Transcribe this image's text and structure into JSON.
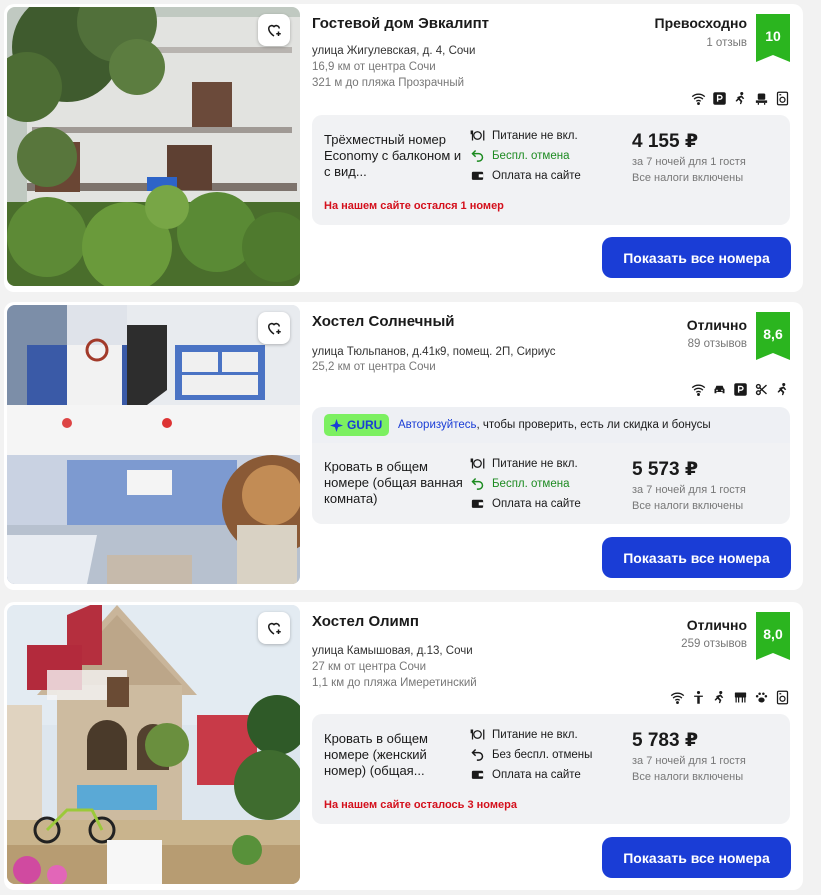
{
  "hotels": [
    {
      "name": "Гостевой дом Эвкалипт",
      "address": "улица Жигулевская, д. 4, Сочи",
      "distance_center": "16,9 км от центра Сочи",
      "distance_beach": "321 м до пляжа Прозрачный",
      "rating_word": "Превосходно",
      "reviews": "1 отзыв",
      "score": "10",
      "amenities": [
        "wifi-icon",
        "parking-icon",
        "kids-icon",
        "meeting-icon",
        "washer-icon"
      ],
      "room": "Трёхместный номер Economy с балконом и с вид...",
      "meal": "Питание не вкл.",
      "cancel": "Беспл. отмена",
      "payment": "Оплата на сайте",
      "price": "4 155 ₽",
      "price_note": "за 7 ночей для 1 гостя",
      "tax_note": "Все налоги включены",
      "availability": "На нашем сайте остался 1 номер",
      "button": "Показать все номера"
    },
    {
      "name": "Хостел Солнечный",
      "address": "улица Тюльпанов, д.41к9, помещ. 2П, Сириус",
      "distance_center": "25,2 км от центра Сочи",
      "rating_word": "Отлично",
      "reviews": "89 отзывов",
      "score": "8,6",
      "amenities": [
        "wifi-icon",
        "car-icon",
        "parking-icon",
        "hairdryer-icon",
        "kids-icon"
      ],
      "guru_label": "GURU",
      "guru_link": "Авторизуйтесь",
      "guru_text": ", чтобы проверить, есть ли скидка и бонусы",
      "room": "Кровать в общем номере (общая ванная комната)",
      "meal": "Питание не вкл.",
      "cancel": "Беспл. отмена",
      "payment": "Оплата на сайте",
      "price": "5 573 ₽",
      "price_note": "за 7 ночей для 1 гостя",
      "tax_note": "Все налоги включены",
      "button": "Показать все номера"
    },
    {
      "name": "Хостел Олимп",
      "address": "улица Камышовая, д.13, Сочи",
      "distance_center": "27 км от центра Сочи",
      "distance_beach": "1,1 км до пляжа Имеретинский",
      "rating_word": "Отлично",
      "reviews": "259 отзывов",
      "score": "8,0",
      "amenities": [
        "wifi-icon",
        "person-icon",
        "kids-icon",
        "kitchen-icon",
        "pets-icon",
        "washer-icon"
      ],
      "room": "Кровать в общем номере (женский номер) (общая...",
      "meal": "Питание не вкл.",
      "cancel": "Без беспл. отмены",
      "payment": "Оплата на сайте",
      "price": "5 783 ₽",
      "price_note": "за 7 ночей для 1 гостя",
      "tax_note": "Все налоги включены",
      "availability": "На нашем сайте осталось 3 номера",
      "button": "Показать все номера"
    }
  ],
  "colors": {
    "accent": "#1a3dd6",
    "score_badge": "#2bb51f",
    "success": "#1d8b21",
    "alert": "#d4101c"
  }
}
